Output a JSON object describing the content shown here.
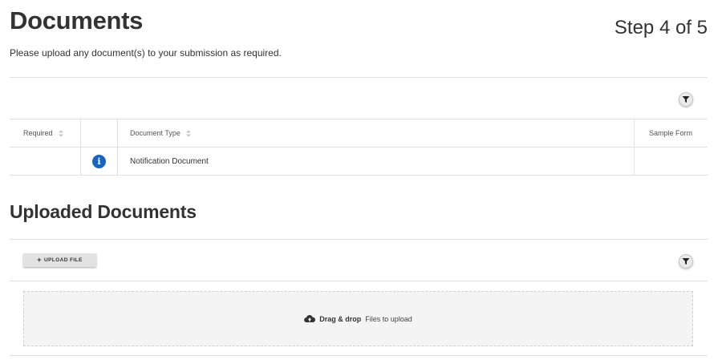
{
  "header": {
    "title": "Documents",
    "subtitle": "Please upload any document(s) to your submission as required.",
    "step": "Step 4 of 5"
  },
  "required_documents": {
    "columns": {
      "required": "Required",
      "info": "",
      "document_type": "Document Type",
      "sample_form": "Sample Form"
    },
    "rows": [
      {
        "required": "",
        "info_icon": "info-icon",
        "document_type": "Notification Document",
        "sample_form": ""
      }
    ],
    "filter_icon": "filter-icon"
  },
  "uploaded": {
    "title": "Uploaded Documents",
    "upload_button": {
      "icon": "+",
      "label": "UPLOAD FILE"
    },
    "filter_icon": "filter-icon",
    "drop_zone": {
      "icon": "cloud-upload-icon",
      "strong": "Drag & drop",
      "text": "Files to upload"
    }
  },
  "colors": {
    "info_blue": "#1565c0",
    "text": "#333333",
    "border": "#e0e0e0",
    "drop_bg": "#f4f4f4"
  }
}
